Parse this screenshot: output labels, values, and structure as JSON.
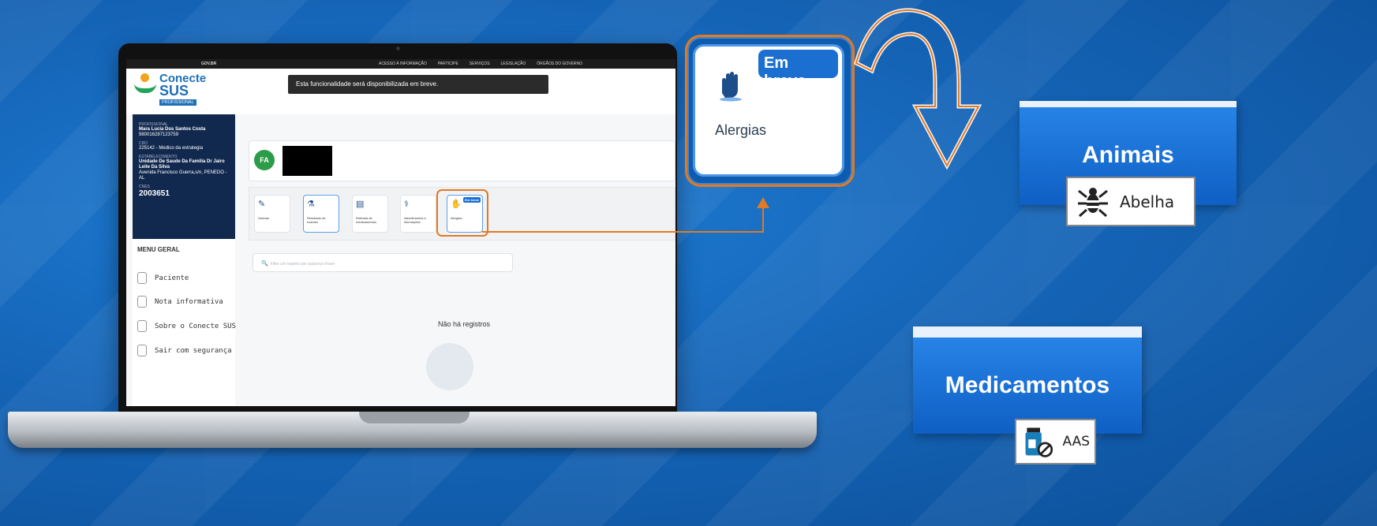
{
  "govbar": {
    "gov_label": "GOV.BR",
    "links": [
      "ACESSO À INFORMAÇÃO",
      "PARTICIPE",
      "SERVIÇOS",
      "LEGISLAÇÃO",
      "ÓRGÃOS DO GOVERNO"
    ]
  },
  "logo": {
    "line1": "Conecte",
    "line2": "SUS",
    "tag": "PROFISSIONAL"
  },
  "toast": "Esta funcionalidade será disponibilizada em breve.",
  "profile": {
    "role_label": "PROFISSIONAL",
    "name": "Mara Lucia Dos Santos Costa",
    "cns": "980016287123759",
    "cbo_label": "CBO",
    "cbo": "225142 - Medico da estrategia",
    "estab_label": "ESTABELECIMENTO",
    "estab": "Unidade De Saude Da Familia Dr Jairo Leite Da Silva",
    "address": "Avenida Francisco Guerra,s/n, PENEDO - AL",
    "cnes_label": "CNES",
    "cnes": "2003651"
  },
  "menu": {
    "title": "MENU GERAL",
    "items": [
      "Paciente",
      "Nota informativa",
      "Sobre o Conecte SUS",
      "Sair com segurança"
    ]
  },
  "patient": {
    "initials": "FA"
  },
  "actions": [
    {
      "label": "Vacinas",
      "icon": "syringe-icon"
    },
    {
      "label": "Resultado de exames",
      "icon": "microscope-icon"
    },
    {
      "label": "Retirada de medicamentos",
      "icon": "pill-bottle-icon"
    },
    {
      "label": "Atendimentos e internações",
      "icon": "stethoscope-icon"
    },
    {
      "label": "Alergias",
      "icon": "allergy-hand-icon",
      "badge": "Em breve"
    }
  ],
  "search": {
    "placeholder": "Filtre um registro por palavras-chave"
  },
  "empty_state": "Não há registros",
  "zoom": {
    "badge": "Em breve",
    "label": "Alergias"
  },
  "animais": {
    "title": "Animais",
    "button_label": "Abelha"
  },
  "medicamentos": {
    "title": "Medicamentos",
    "button_label": "AAS"
  },
  "colors": {
    "accent": "#e07a24",
    "brand_blue": "#1b6fd1",
    "sidebar": "#12294f"
  }
}
